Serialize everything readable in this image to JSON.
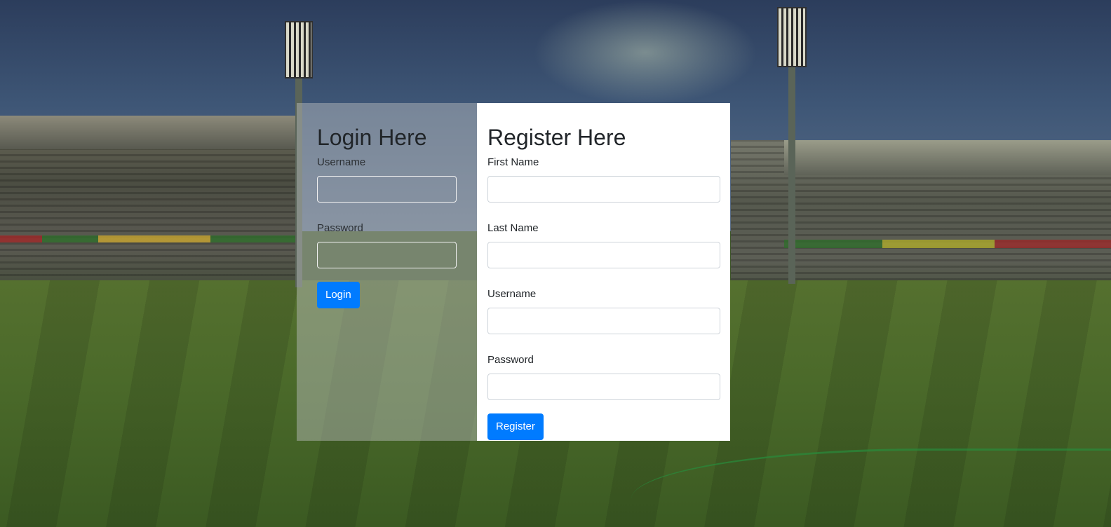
{
  "login": {
    "title": "Login Here",
    "username_label": "Username",
    "username_value": "",
    "password_label": "Password",
    "password_value": "",
    "submit_label": "Login"
  },
  "register": {
    "title": "Register Here",
    "first_name_label": "First Name",
    "first_name_value": "",
    "last_name_label": "Last Name",
    "last_name_value": "",
    "username_label": "Username",
    "username_value": "",
    "password_label": "Password",
    "password_value": "",
    "submit_label": "Register"
  },
  "colors": {
    "primary_button": "#007bff",
    "register_panel": "#ffffff",
    "login_panel_overlay": "rgba(190,192,196,0.45)"
  },
  "background": {
    "description_icon": "cricket-stadium-background"
  }
}
